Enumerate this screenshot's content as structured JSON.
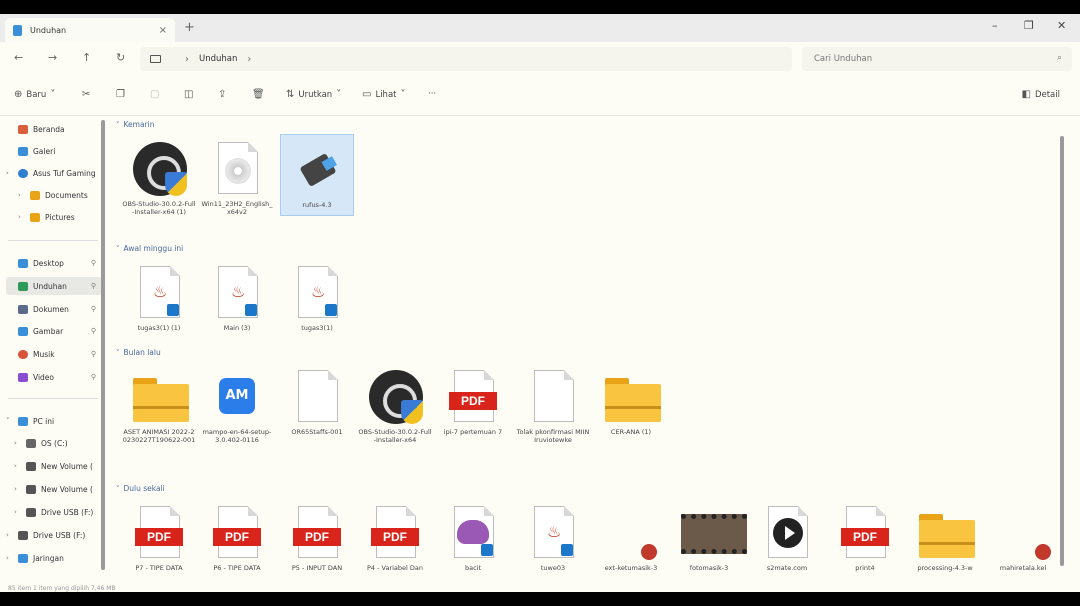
{
  "tab": {
    "title": "Unduhan",
    "close": "×",
    "new": "+"
  },
  "window": {
    "minimize": "–",
    "maximize": "❐",
    "close": "✕"
  },
  "nav": {
    "back": "←",
    "forward": "→",
    "up": "↑",
    "refresh": "↻"
  },
  "address": {
    "crumb": "Unduhan",
    "sep": "›",
    "end": "›"
  },
  "search": {
    "placeholder": "Cari Unduhan",
    "icon": "⌕"
  },
  "commands": {
    "new": "Baru",
    "sort": "Urutkan",
    "view": "Lihat",
    "more": "···",
    "details": "Detail"
  },
  "sidebar": {
    "items": [
      {
        "label": "Beranda",
        "color": "#d95f3b"
      },
      {
        "label": "Galeri",
        "color": "#3a8fd8"
      },
      {
        "label": "Asus Tuf Gaming",
        "color": "#2f7fd0"
      },
      {
        "label": "Documents",
        "color": "#e8a317"
      },
      {
        "label": "Pictures",
        "color": "#e8a317"
      },
      {
        "label": "Desktop",
        "color": "#3a8fd8"
      },
      {
        "label": "Unduhan",
        "color": "#2e9a5a"
      },
      {
        "label": "Dokumen",
        "color": "#5a6a8a"
      },
      {
        "label": "Gambar",
        "color": "#3a8fd8"
      },
      {
        "label": "Musik",
        "color": "#d9533b"
      },
      {
        "label": "Video",
        "color": "#8a4fd0"
      },
      {
        "label": "PC ini",
        "color": "#3a8fd8"
      },
      {
        "label": "OS (C:)",
        "color": "#666666"
      },
      {
        "label": "New Volume (",
        "color": "#555555"
      },
      {
        "label": "New Volume (",
        "color": "#555555"
      },
      {
        "label": "Drive USB (F:)",
        "color": "#555555"
      },
      {
        "label": "Drive USB (F:) ",
        "color": "#555555"
      },
      {
        "label": "Jaringan",
        "color": "#3a8fd8"
      }
    ]
  },
  "groups": [
    {
      "label": "Kemarin"
    },
    {
      "label": "Awal minggu ini"
    },
    {
      "label": "Bulan lalu"
    },
    {
      "label": "Dulu sekali"
    }
  ],
  "files": {
    "yesterday": [
      {
        "name": "OBS-Studio-30.0.2-Full-Installer-x64 (1)",
        "kind": "obs"
      },
      {
        "name": "Win11_23H2_English_x64v2",
        "kind": "disc"
      },
      {
        "name": "rufus-4.3",
        "kind": "usb"
      }
    ],
    "thisweek": [
      {
        "name": "tugas3(1) (1)",
        "kind": "java"
      },
      {
        "name": "Main (3)",
        "kind": "java"
      },
      {
        "name": "tugas3(1)",
        "kind": "java"
      }
    ],
    "lastmonth": [
      {
        "name": "ASET ANIMASI 2022-20230227T190622-001",
        "kind": "folder"
      },
      {
        "name": "mampo-en-64-setup-3.0.402-0116",
        "kind": "am"
      },
      {
        "name": "OR65Staffs-001",
        "kind": "blank"
      },
      {
        "name": "OBS-Studio-30.0.2-Full-Installer-x64",
        "kind": "obs"
      },
      {
        "name": "ipi-7 pertemuan 7",
        "kind": "pdf"
      },
      {
        "name": "Tolak pkonfirmasi MIINIruviotewke",
        "kind": "blank"
      },
      {
        "name": "CER-ANA (1)",
        "kind": "folder"
      }
    ],
    "longago": [
      {
        "name": "P7 - TIPE DATA",
        "kind": "pdf"
      },
      {
        "name": "P6 - TIPE DATA",
        "kind": "pdf"
      },
      {
        "name": "P5 - INPUT DAN",
        "kind": "pdf"
      },
      {
        "name": "P4 - Variabel Dan",
        "kind": "pdf"
      },
      {
        "name": "bacit",
        "kind": "elephant"
      },
      {
        "name": "tuwe03",
        "kind": "java"
      },
      {
        "name": "ext-ketumasik-3",
        "kind": "ppt"
      },
      {
        "name": "fotomasik-3",
        "kind": "video"
      },
      {
        "name": "s2mate.com",
        "kind": "play"
      },
      {
        "name": "print4",
        "kind": "pdf"
      },
      {
        "name": "processing-4.3-w",
        "kind": "folder"
      },
      {
        "name": "mahiretala.kel",
        "kind": "ppt"
      }
    ]
  },
  "status": {
    "text": "85 item    1 item yang dipilih  7,46 MB"
  },
  "pdf_label": "PDF",
  "am_label": "AM"
}
